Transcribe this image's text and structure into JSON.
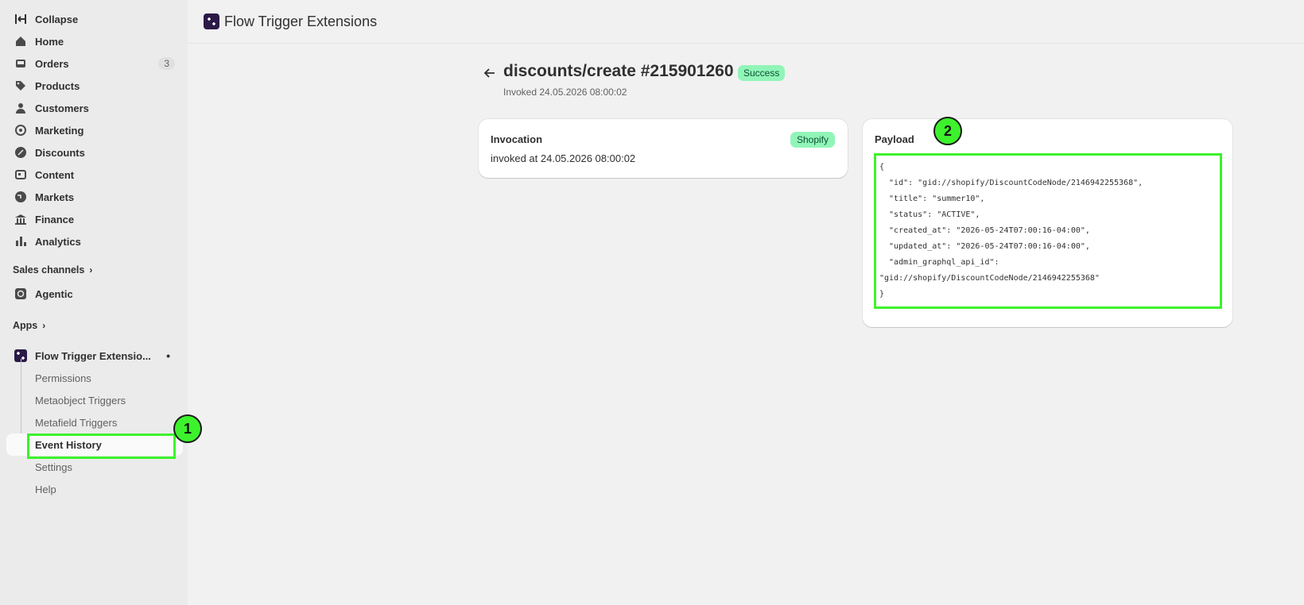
{
  "sidebar": {
    "collapse_label": "Collapse",
    "items": [
      {
        "label": "Home"
      },
      {
        "label": "Orders",
        "count": "3"
      },
      {
        "label": "Products"
      },
      {
        "label": "Customers"
      },
      {
        "label": "Marketing"
      },
      {
        "label": "Discounts"
      },
      {
        "label": "Content"
      },
      {
        "label": "Markets"
      },
      {
        "label": "Finance"
      },
      {
        "label": "Analytics"
      }
    ],
    "sales_channels_label": "Sales channels",
    "agentic_label": "Agentic",
    "apps_label": "Apps",
    "app_name": "Flow Trigger Extensio...",
    "sub_items": [
      {
        "label": "Permissions"
      },
      {
        "label": "Metaobject Triggers"
      },
      {
        "label": "Metafield Triggers"
      },
      {
        "label": "Event History"
      },
      {
        "label": "Settings"
      },
      {
        "label": "Help"
      }
    ]
  },
  "topbar": {
    "title": "Flow Trigger Extensions"
  },
  "page": {
    "title": "discounts/create #215901260",
    "status": "Success",
    "subtitle": "Invoked 24.05.2026 08:00:02"
  },
  "invocation": {
    "title": "Invocation",
    "badge": "Shopify",
    "text": "invoked at 24.05.2026 08:00:02"
  },
  "payload": {
    "title": "Payload",
    "code": "{\n  \"id\": \"gid://shopify/DiscountCodeNode/2146942255368\",\n  \"title\": \"summer10\",\n  \"status\": \"ACTIVE\",\n  \"created_at\": \"2026-05-24T07:00:16-04:00\",\n  \"updated_at\": \"2026-05-24T07:00:16-04:00\",\n  \"admin_graphql_api_id\":\n\"gid://shopify/DiscountCodeNode/2146942255368\"\n}"
  },
  "annotations": {
    "marker_1": "1",
    "marker_2": "2"
  },
  "colors": {
    "highlight": "#3df22c",
    "success_badge": "#91f5b8",
    "app_icon": "#2b1a47"
  }
}
